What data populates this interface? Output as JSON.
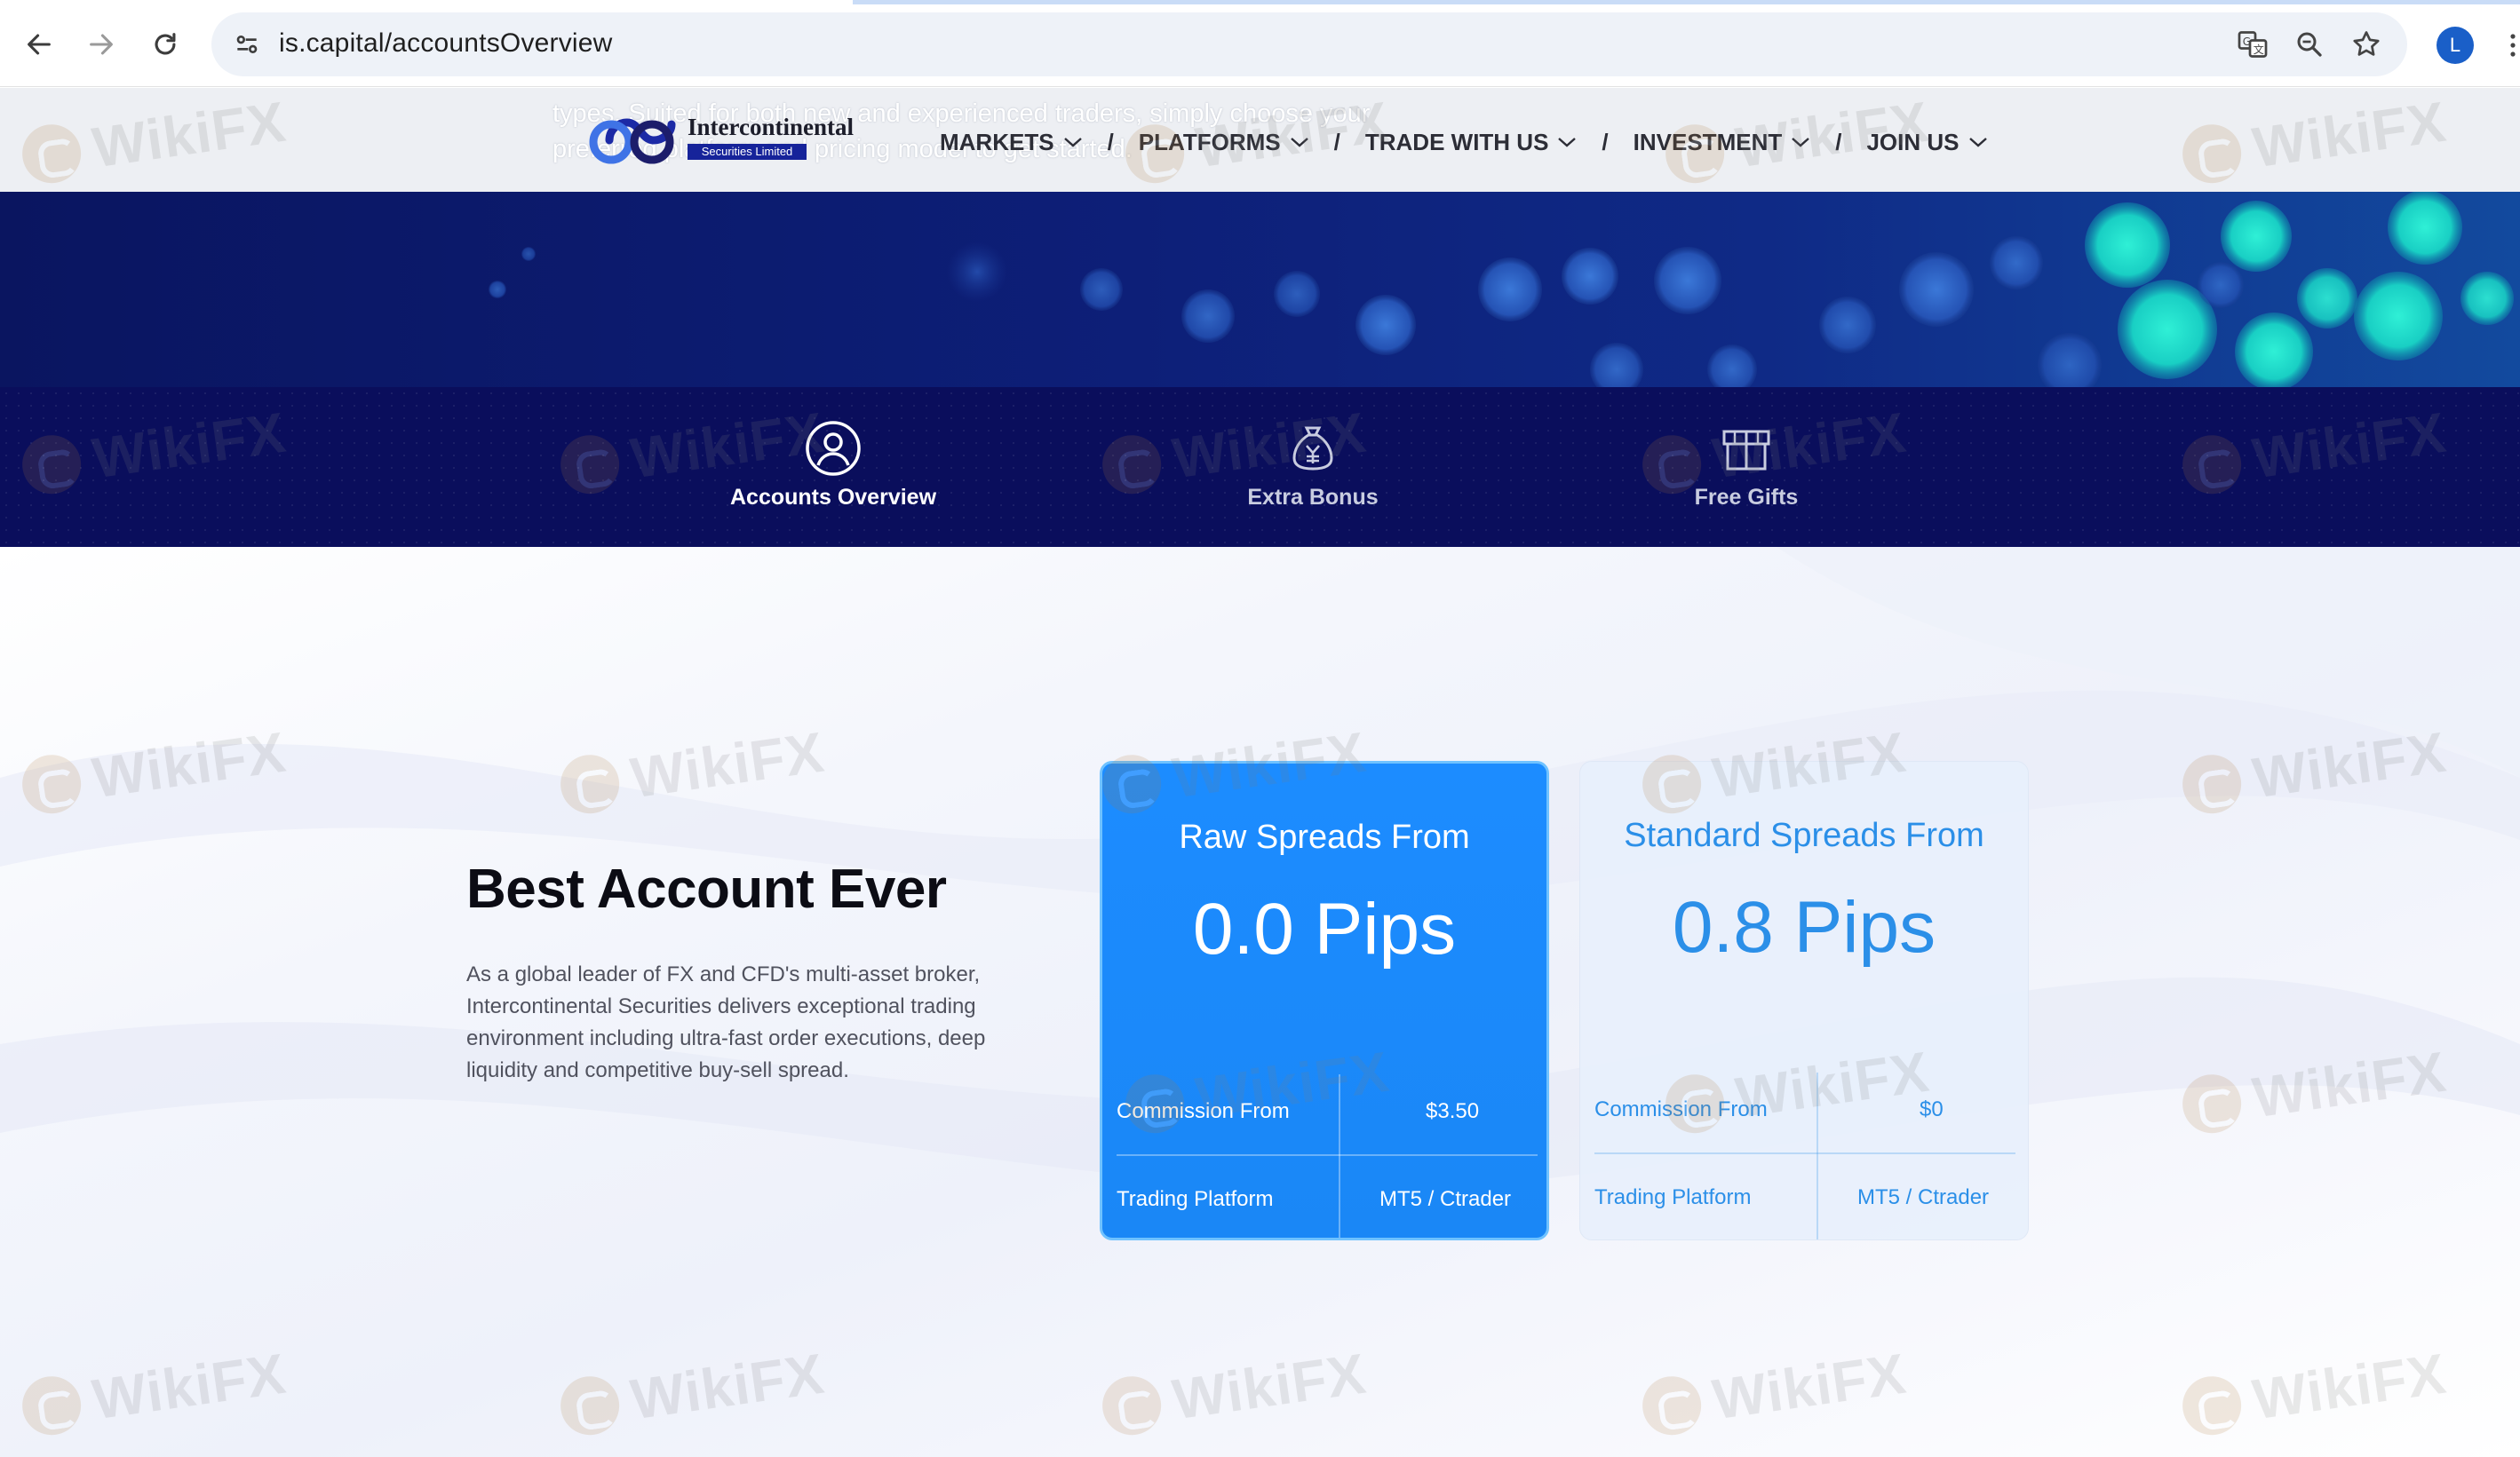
{
  "browser": {
    "url": "is.capital/accountsOverview",
    "profile_initial": "L",
    "icons": [
      "back-arrow-icon",
      "forward-arrow-icon",
      "reload-icon",
      "site-info-icon",
      "translate-icon",
      "zoom-icon",
      "bookmark-star-icon",
      "kebab-menu-icon"
    ]
  },
  "header": {
    "overlap_text": "types. Suited for both new and experienced traders, simply choose your preferred platform and pricing model to get started.",
    "logo": {
      "name": "Intercontinental",
      "subtitle": "Securities Limited"
    },
    "nav": [
      {
        "label": "MARKETS"
      },
      {
        "label": "PLATFORMS"
      },
      {
        "label": "TRADE WITH US"
      },
      {
        "label": "INVESTMENT"
      },
      {
        "label": "JOIN US"
      }
    ],
    "separator": "/"
  },
  "tabs": [
    {
      "label": "Accounts Overview",
      "icon": "user-circle-icon",
      "active": true
    },
    {
      "label": "Extra Bonus",
      "icon": "money-bag-icon",
      "active": false
    },
    {
      "label": "Free Gifts",
      "icon": "gift-box-icon",
      "active": false
    }
  ],
  "section": {
    "title": "Best Account Ever",
    "description": "As a global leader of FX and CFD's multi-asset broker, Intercontinental Securities delivers exceptional trading environment including ultra-fast order executions, deep liquidity and competitive buy-sell spread."
  },
  "cards": [
    {
      "heading": "Raw Spreads From",
      "value": "0.0 Pips",
      "commission_label": "Commission From",
      "commission_value": "$3.50",
      "platform_label": "Trading Platform",
      "platform_value": "MT5 / Ctrader"
    },
    {
      "heading": "Standard Spreads From",
      "value": "0.8 Pips",
      "commission_label": "Commission From",
      "commission_value": "$0",
      "platform_label": "Trading Platform",
      "platform_value": "MT5 / Ctrader"
    }
  ],
  "watermark": {
    "text": "WikiFX"
  },
  "colors": {
    "tab_strip": "#0a0e5c",
    "card_raw": "#1c8cff",
    "card_std_text": "#2b8fe8",
    "tab_active": "#ffffff",
    "tab_inactive": "#c8cce0"
  }
}
